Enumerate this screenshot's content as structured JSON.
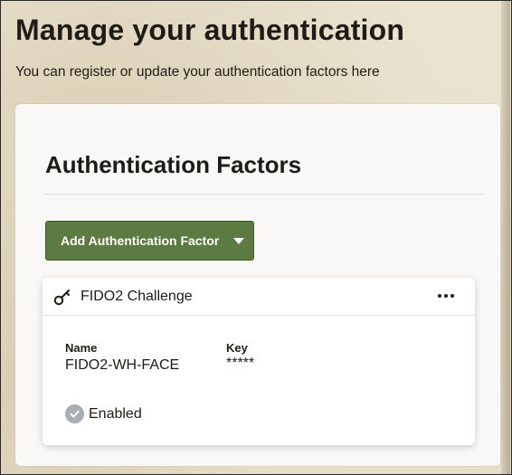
{
  "page": {
    "title": "Manage your authentication",
    "subtitle": "You can register or update your authentication factors here"
  },
  "section": {
    "title": "Authentication Factors",
    "add_button_label": "Add Authentication Factor"
  },
  "factor": {
    "icon": "key-icon",
    "name": "FIDO2 Challenge",
    "fields": [
      {
        "label": "Name",
        "value": "FIDO2-WH-FACE"
      },
      {
        "label": "Key",
        "value": "*****"
      }
    ],
    "status": "Enabled"
  },
  "colors": {
    "accent_button": "#5c7a42",
    "status_check": "#a9aeb3",
    "background": "#ebe3d1"
  }
}
